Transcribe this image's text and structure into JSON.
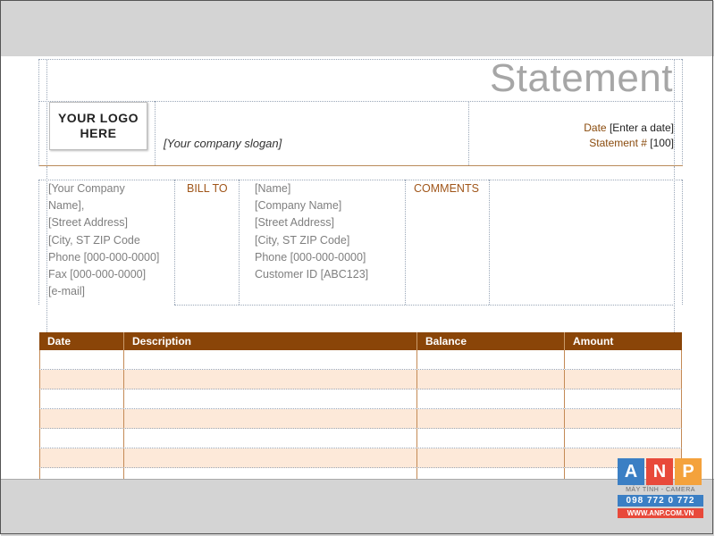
{
  "document": {
    "title": "Statement",
    "logo_text": "YOUR LOGO HERE",
    "slogan": "[Your company slogan]",
    "date_label": "Date",
    "date_value": "[Enter a date]",
    "statement_label": "Statement #",
    "statement_value": "[100]"
  },
  "company_info": [
    "[Your Company",
    "Name],",
    "[Street Address]",
    "[City, ST  ZIP Code",
    "Phone [000-000-0000]",
    "Fax [000-000-0000]",
    "[e-mail]"
  ],
  "bill_to": {
    "label": "BILL TO",
    "lines": [
      "[Name]",
      "[Company Name]",
      "[Street Address]",
      "[City, ST  ZIP Code]",
      "Phone [000-000-0000]",
      "Customer ID [ABC123]"
    ]
  },
  "comments_label": "COMMENTS",
  "table": {
    "headers": [
      "Date",
      "Description",
      "Balance",
      "Amount"
    ],
    "row_count": 7
  },
  "watermark": {
    "letters": [
      "A",
      "N",
      "P"
    ],
    "letter_colors": [
      "#3b7fc4",
      "#e8493a",
      "#f4a23c"
    ],
    "subtitle": "MÁY TÍNH - CAMERA",
    "phone": "098 772 0 772",
    "website": "WWW.ANP.COM.VN"
  }
}
